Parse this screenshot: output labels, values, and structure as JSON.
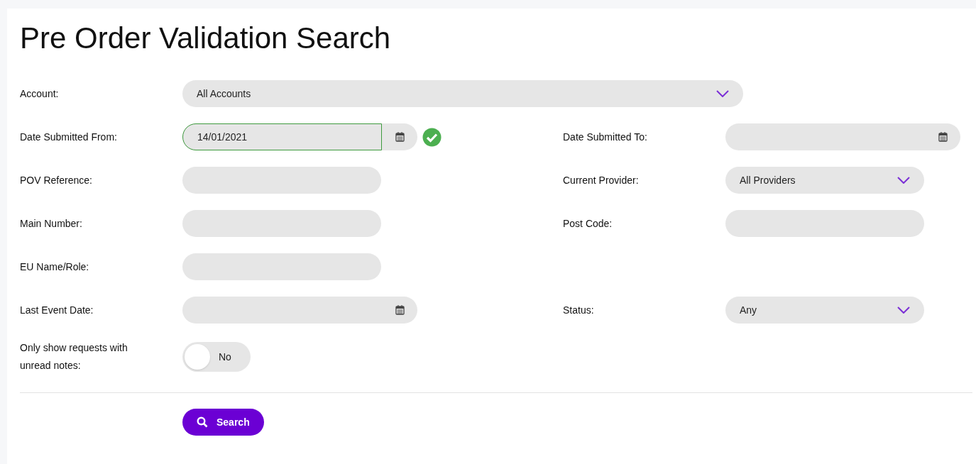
{
  "title": "Pre Order Validation Search",
  "account": {
    "label": "Account:",
    "value": "All Accounts"
  },
  "rows": [
    {
      "left": {
        "kind": "date",
        "label": "Date Submitted From:",
        "value": "14/01/2021",
        "valid": true
      },
      "right": {
        "kind": "date",
        "label": "Date Submitted To:",
        "valid": false
      }
    },
    {
      "left": {
        "kind": "text",
        "label": "POV Reference:"
      },
      "right": {
        "kind": "select",
        "label": "Current Provider:",
        "value": "All Providers"
      }
    },
    {
      "left": {
        "kind": "text",
        "label": "Main Number:"
      },
      "right": {
        "kind": "text",
        "label": "Post Code:"
      }
    },
    {
      "left": {
        "kind": "text",
        "label": "EU Name/Role:"
      },
      "right": null
    },
    {
      "left": {
        "kind": "date",
        "label": "Last Event Date:",
        "valid": false
      },
      "right": {
        "kind": "select",
        "label": "Status:",
        "value": "Any"
      }
    }
  ],
  "unread_toggle": {
    "label": "Only show requests with unread notes:",
    "on": false,
    "text": "No"
  },
  "search_button": {
    "label": "Search"
  }
}
